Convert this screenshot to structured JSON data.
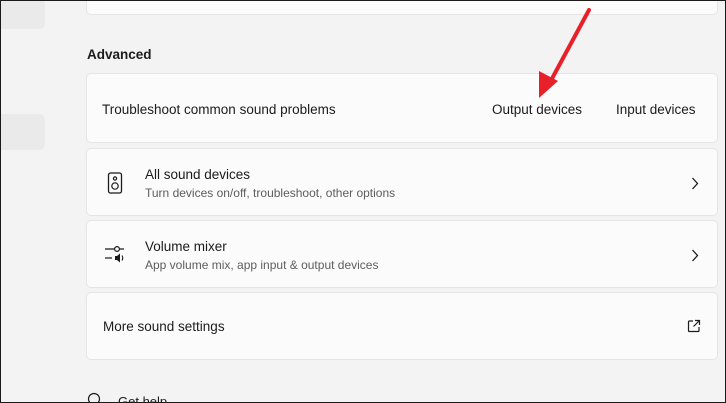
{
  "section": {
    "title": "Advanced"
  },
  "troubleshoot": {
    "label": "Troubleshoot common sound problems",
    "output_link": "Output devices",
    "input_link": "Input devices"
  },
  "all_devices": {
    "title": "All sound devices",
    "subtitle": "Turn devices on/off, troubleshoot, other options",
    "icon": "speaker-icon"
  },
  "volume_mixer": {
    "title": "Volume mixer",
    "subtitle": "App volume mix, app input & output devices",
    "icon": "volume-mixer-icon"
  },
  "more_settings": {
    "title": "More sound settings",
    "icon": "open-external-icon"
  },
  "help": {
    "label": "Get help"
  },
  "colors": {
    "annotation_arrow": "#e8202a",
    "card_bg": "#fbfbfb",
    "page_bg": "#f3f3f3"
  }
}
